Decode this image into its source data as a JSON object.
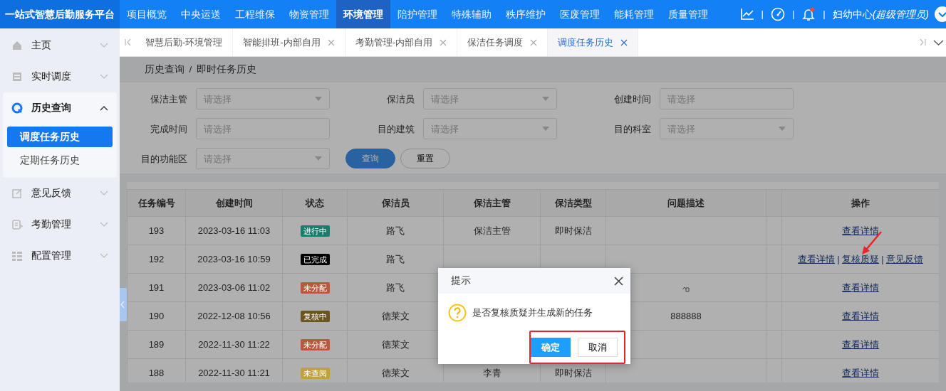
{
  "app_title": "一站式智慧后勤服务平台",
  "top_nav": [
    {
      "label": "项目概览",
      "selected": false
    },
    {
      "label": "中央运送",
      "selected": false
    },
    {
      "label": "工程维保",
      "selected": false
    },
    {
      "label": "物资管理",
      "selected": false
    },
    {
      "label": "环境管理",
      "selected": true
    },
    {
      "label": "陪护管理",
      "selected": false
    },
    {
      "label": "特殊辅助",
      "selected": false
    },
    {
      "label": "秩序维护",
      "selected": false
    },
    {
      "label": "医废管理",
      "selected": false
    },
    {
      "label": "能耗管理",
      "selected": false
    },
    {
      "label": "质量管理",
      "selected": false
    }
  ],
  "header": {
    "separator": "|",
    "has_notification": true,
    "user": "妇幼中心",
    "role": "(超级管理员)"
  },
  "sidebar": [
    {
      "label": "主页",
      "expanded": false
    },
    {
      "label": "实时调度",
      "expanded": false
    },
    {
      "label": "历史查询",
      "expanded": true,
      "children": [
        {
          "label": "调度任务历史",
          "selected": true
        },
        {
          "label": "定期任务历史",
          "selected": false
        }
      ]
    },
    {
      "label": "意见反馈",
      "expanded": false
    },
    {
      "label": "考勤管理",
      "expanded": false
    },
    {
      "label": "配置管理",
      "expanded": false
    }
  ],
  "tabs": [
    {
      "label": "智慧后勤-环境管理",
      "selected": false,
      "closable": false
    },
    {
      "label": "智能排班-内部自用",
      "selected": false,
      "closable": true
    },
    {
      "label": "考勤管理-内部自用",
      "selected": false,
      "closable": true
    },
    {
      "label": "保洁任务调度",
      "selected": false,
      "closable": true
    },
    {
      "label": "调度任务历史",
      "selected": true,
      "closable": true
    }
  ],
  "breadcrumb": [
    "历史查询",
    "即时任务历史"
  ],
  "breadcrumb_separator": "/",
  "filters": [
    {
      "label": "保洁主管",
      "placeholder": "请选择",
      "kind": "select"
    },
    {
      "label": "保洁员",
      "placeholder": "请选择",
      "kind": "select"
    },
    {
      "label": "创建时间",
      "placeholder": "请选择",
      "kind": "date"
    },
    {
      "label": "完成时间",
      "placeholder": "请选择",
      "kind": "date"
    },
    {
      "label": "目的建筑",
      "placeholder": "请选择",
      "kind": "select"
    },
    {
      "label": "目的科室",
      "placeholder": "请选择",
      "kind": "select"
    },
    {
      "label": "目的功能区",
      "placeholder": "请选择",
      "kind": "select"
    }
  ],
  "filter_buttons": [
    {
      "label": "查询",
      "kind": "primary"
    },
    {
      "label": "重置",
      "kind": "default"
    }
  ],
  "table": {
    "action_separator": "|",
    "columns": [
      "任务编号",
      "创建时间",
      "状态",
      "保洁员",
      "保洁主管",
      "保洁类型",
      "问题描述",
      "操作"
    ],
    "rows": [
      {
        "id": "193",
        "created": "2023-03-16 11:03",
        "status": {
          "label": "进行中",
          "color": "#1e7a6a"
        },
        "cleaner": "路飞",
        "supervisor": "保洁主管",
        "type": "即时保洁",
        "actions": [
          "查看详情"
        ]
      },
      {
        "id": "192",
        "created": "2023-03-16 10:59",
        "status": {
          "label": "已完成",
          "color": "#000000"
        },
        "cleaner": "路飞",
        "actions": [
          "查看详情",
          "复核质疑",
          "意见反馈"
        ]
      },
      {
        "id": "191",
        "created": "2023-03-06 11:02",
        "status": {
          "label": "未分配",
          "color": "#b8583f"
        },
        "cleaner": "路飞",
        "has_attachment": true,
        "actions": [
          "查看详情"
        ]
      },
      {
        "id": "190",
        "created": "2022-12-08 10:56",
        "status": {
          "label": "复核中",
          "color": "#6a5520"
        },
        "cleaner": "德莱文",
        "description": "888888",
        "actions": [
          "查看详情"
        ]
      },
      {
        "id": "189",
        "created": "2022-11-30 11:22",
        "status": {
          "label": "未分配",
          "color": "#b8583f"
        },
        "cleaner": "德莱文",
        "actions": [
          "查看详情"
        ]
      },
      {
        "id": "188",
        "created": "2022-11-30 11:21",
        "status": {
          "label": "未查阅",
          "color": "#c0a040"
        },
        "cleaner": "德莱文",
        "supervisor": "李青",
        "type": "即时保洁",
        "actions": [
          "查看详情"
        ]
      }
    ]
  },
  "dialog": {
    "title": "提示",
    "message": "是否复核质疑并生成新的任务",
    "buttons": [
      {
        "label": "确定",
        "kind": "primary"
      },
      {
        "label": "取消",
        "kind": "default"
      }
    ]
  }
}
